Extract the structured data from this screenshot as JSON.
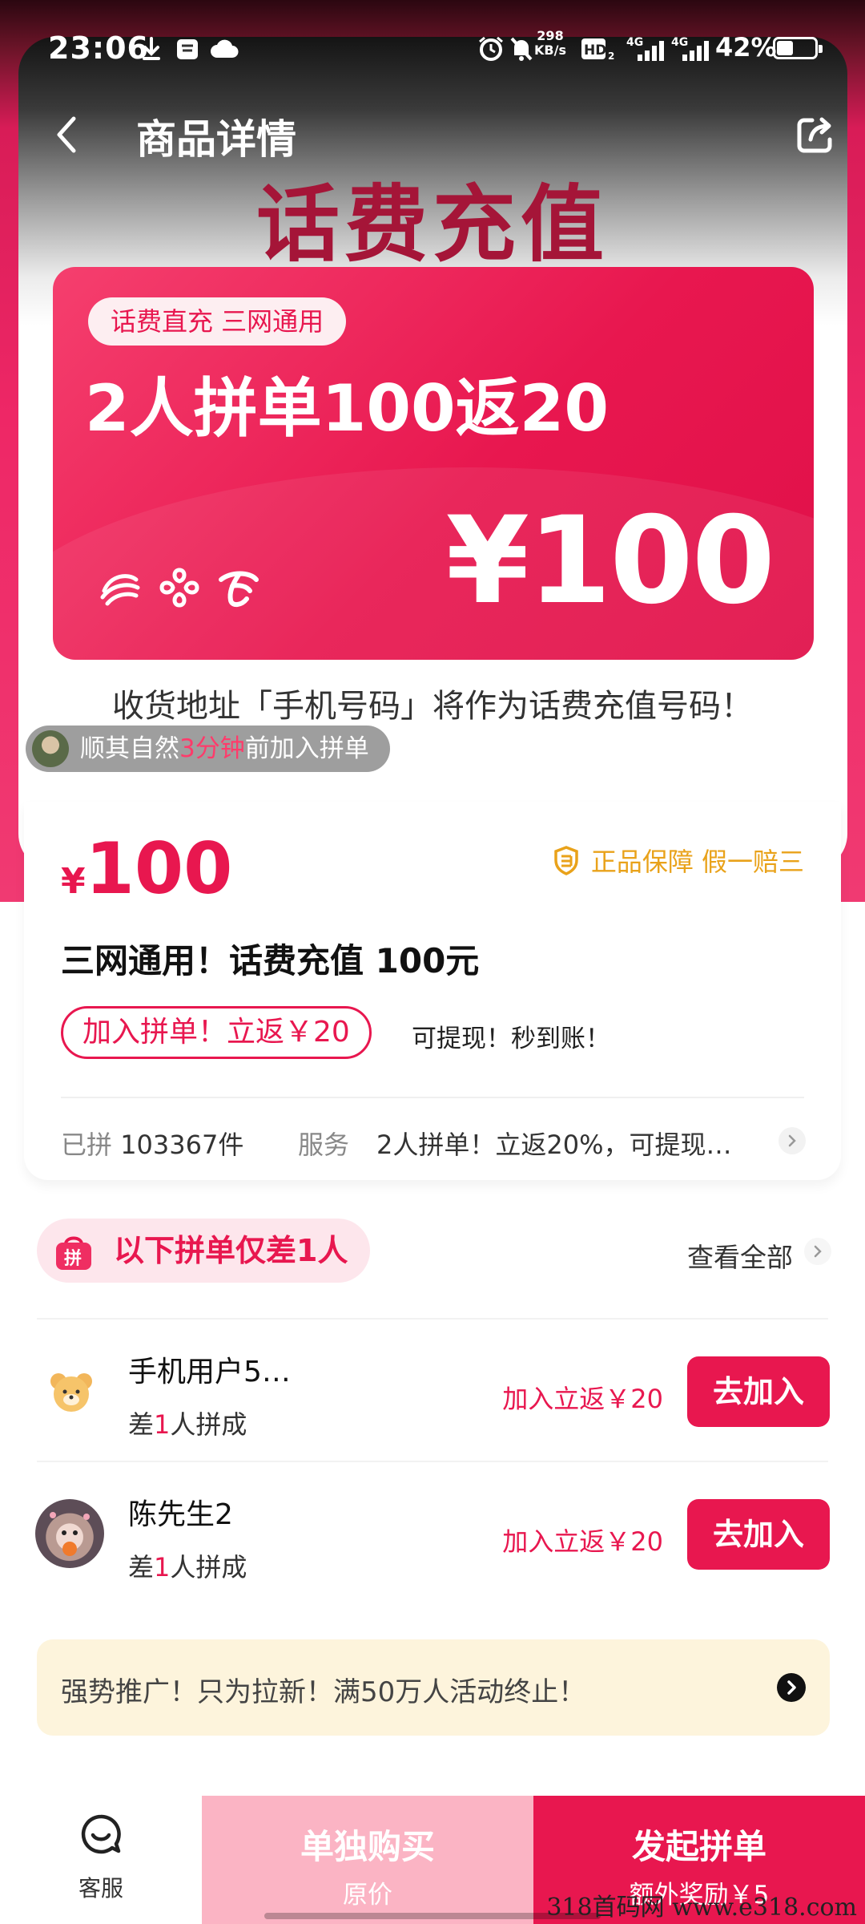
{
  "status_bar": {
    "time": "23:06",
    "net_speed": "298\nKB/s",
    "battery": "42%",
    "icons": [
      "download-icon",
      "store-icon",
      "cloud-icon",
      "alarm-icon",
      "mute-icon",
      "hd-icon",
      "signal-4g-icon",
      "signal-4g-icon",
      "battery-icon"
    ]
  },
  "nav": {
    "title": "商品详情",
    "back_icon": "chevron-left-icon",
    "share_icon": "share-icon"
  },
  "hero": {
    "title": "话费充值",
    "promo_tag": "话费直充 三网通用",
    "promo_headline": "2人拼单100返20",
    "promo_price": "¥100",
    "carriers": [
      "china-mobile-icon",
      "china-unicom-icon",
      "china-telecom-icon"
    ],
    "address_note": "收货地址「手机号码」将作为话费充值号码！"
  },
  "ticker": {
    "name": "顺其自然",
    "time": "3分钟",
    "action": "前加入拼单"
  },
  "product": {
    "price_symbol": "¥",
    "price": "100",
    "guarantee": "正品保障 假一赔三",
    "title": "三网通用！话费充值 100元",
    "join_pill": "加入拼单！立返￥20",
    "pill_note": "可提现！秒到账！",
    "sold_label": "已拼",
    "sold_value": "103367件",
    "service_label": "服务",
    "service_text": "2人拼单！立返20%，可提现…"
  },
  "groups": {
    "badge": "以下拼单仅差1人",
    "view_all": "查看全部",
    "items": [
      {
        "name": "手机用户5…",
        "sub_prefix": "差",
        "sub_num": "1",
        "sub_suffix": "人拼成",
        "reward": "加入立返￥20",
        "button": "去加入"
      },
      {
        "name": "陈先生2",
        "sub_prefix": "差",
        "sub_num": "1",
        "sub_suffix": "人拼成",
        "reward": "加入立返￥20",
        "button": "去加入"
      }
    ]
  },
  "notice": {
    "text": "强势推广！只为拉新！满50万人活动终止！"
  },
  "bottom": {
    "service_label": "客服",
    "solo_main": "单独购买",
    "solo_sub": "原价",
    "group_main": "发起拼单",
    "group_sub": "额外奖励￥5"
  },
  "watermark": "318首码网  www.e318.com",
  "colors": {
    "accent": "#e8174f",
    "gold": "#e9a21a",
    "notice_bg": "#fdf4dc",
    "solo_bg": "#fbb4c4"
  }
}
